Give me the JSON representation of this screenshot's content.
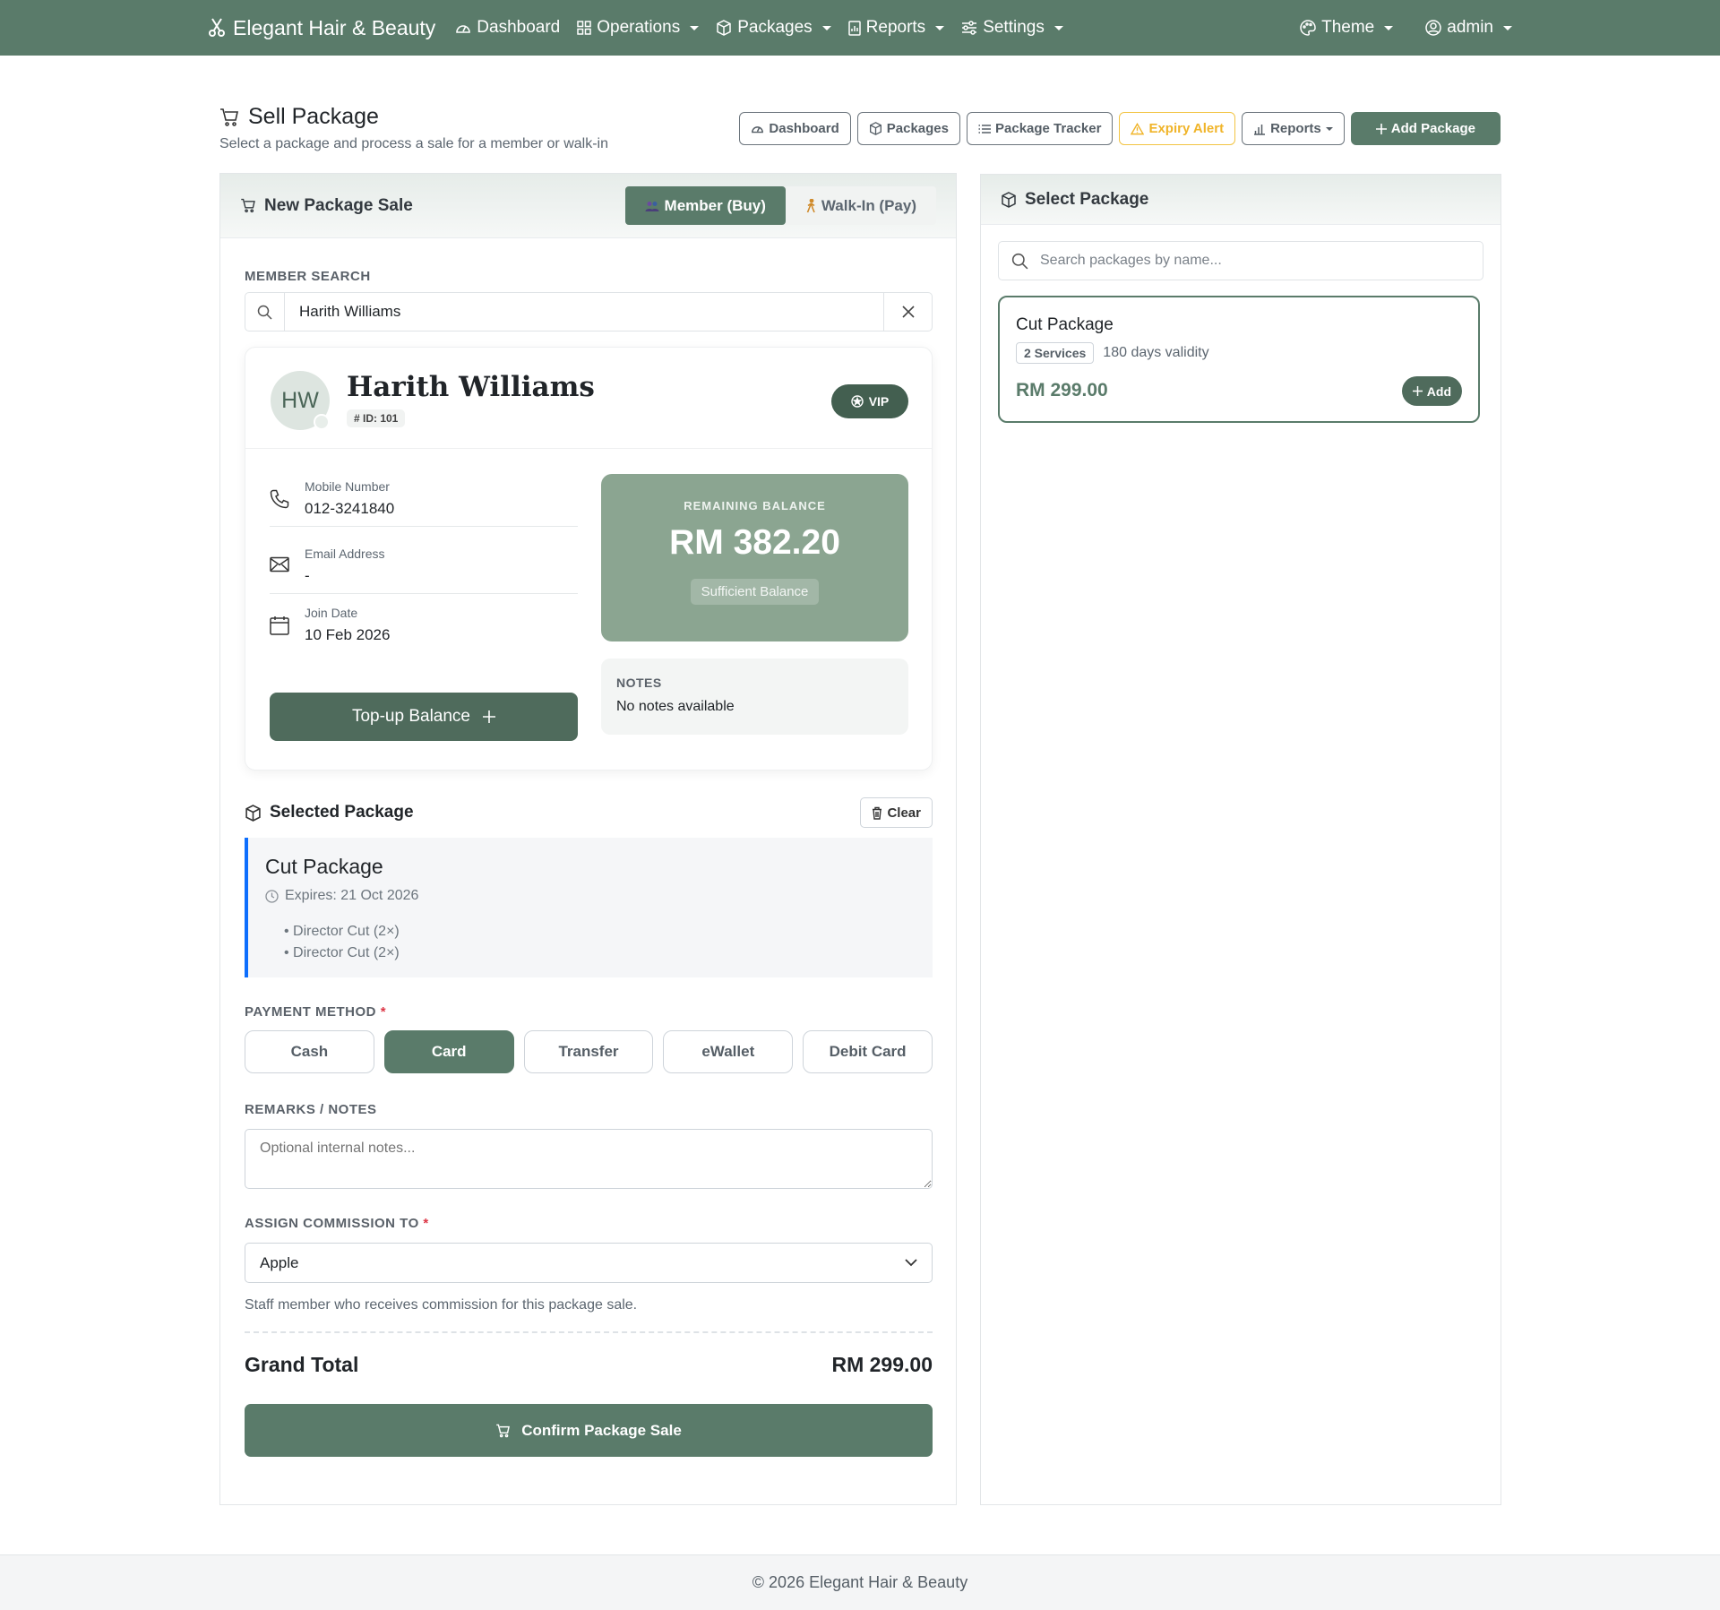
{
  "nav": {
    "brand": "Elegant Hair & Beauty",
    "items": [
      {
        "label": "Dashboard",
        "icon": "speedometer-icon"
      },
      {
        "label": "Operations",
        "icon": "grid-icon",
        "dropdown": true
      },
      {
        "label": "Packages",
        "icon": "box-icon",
        "dropdown": true
      },
      {
        "label": "Reports",
        "icon": "report-icon",
        "dropdown": true
      },
      {
        "label": "Settings",
        "icon": "sliders-icon",
        "dropdown": true
      }
    ],
    "theme": "Theme",
    "user": "admin"
  },
  "page": {
    "title": "Sell Package",
    "subtitle": "Select a package and process a sale for a member or walk-in"
  },
  "toolbar": {
    "dashboard": "Dashboard",
    "packages": "Packages",
    "tracker": "Package Tracker",
    "expiry": "Expiry Alert",
    "reports": "Reports",
    "add": "Add Package"
  },
  "sale": {
    "title": "New Package Sale",
    "mode_member": "Member (Buy)",
    "mode_walkin": "Walk-In (Pay)",
    "member_search_label": "Member Search",
    "member_search_value": "Harith Williams"
  },
  "member": {
    "initials": "HW",
    "name": "Harith Williams",
    "id": "# ID: 101",
    "tier": "VIP",
    "mobile_label": "Mobile Number",
    "mobile": "012-3241840",
    "email_label": "Email Address",
    "email": "-",
    "join_label": "Join Date",
    "join": "10 Feb 2026",
    "topup": "Top-up Balance",
    "balance_label": "Remaining Balance",
    "balance": "RM 382.20",
    "balance_status": "Sufficient Balance",
    "notes_label": "Notes",
    "notes": "No notes available"
  },
  "selected": {
    "heading": "Selected Package",
    "clear": "Clear",
    "name": "Cut Package",
    "expires": "Expires: 21 Oct 2026",
    "services": [
      "• Director Cut (2×)",
      "• Director Cut (2×)"
    ]
  },
  "payment": {
    "label": "Payment Method",
    "required": "*",
    "methods": [
      "Cash",
      "Card",
      "Transfer",
      "eWallet",
      "Debit Card"
    ],
    "selected": "Card"
  },
  "remarks": {
    "label": "Remarks / Notes",
    "placeholder": "Optional internal notes..."
  },
  "commission": {
    "label": "Assign Commission To",
    "required": "*",
    "value": "Apple",
    "help": "Staff member who receives commission for this package sale."
  },
  "total": {
    "label": "Grand Total",
    "value": "RM 299.00"
  },
  "confirm": "Confirm Package Sale",
  "catalog": {
    "title": "Select Package",
    "search_placeholder": "Search packages by name...",
    "packages": [
      {
        "name": "Cut Package",
        "services": "2 Services",
        "validity": "180 days validity",
        "price": "RM 299.00",
        "add": "Add"
      }
    ]
  },
  "footer": "© 2026 Elegant Hair & Beauty",
  "colors": {
    "primary": "#5a7b6a",
    "balance_card": "#8ba591",
    "accent_border": "#0d6efd",
    "warning": "#f0b429"
  }
}
